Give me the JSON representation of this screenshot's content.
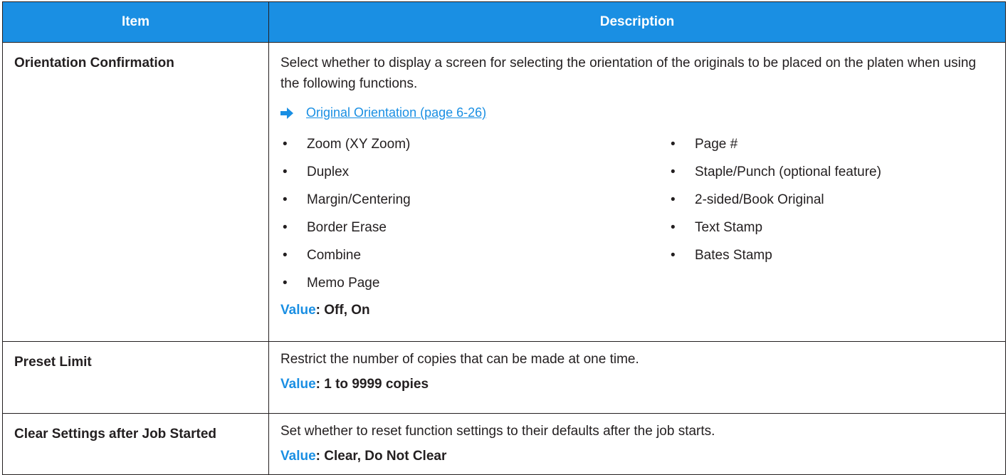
{
  "table": {
    "headers": {
      "item": "Item",
      "description": "Description"
    },
    "rows": [
      {
        "item": "Orientation Confirmation",
        "text": "Select whether to display a screen for selecting the orientation of the originals to be placed on the platen when using the following functions.",
        "reference": "Original Orientation (page 6-26)",
        "list_left": [
          "Zoom (XY Zoom)",
          "Duplex",
          "Margin/Centering",
          "Border Erase",
          "Combine",
          "Memo Page"
        ],
        "list_right": [
          "Page #",
          "Staple/Punch (optional feature)",
          "2-sided/Book Original",
          "Text Stamp",
          "Bates Stamp"
        ],
        "value_label": "Value",
        "value": ": Off, On"
      },
      {
        "item": "Preset Limit",
        "text": "Restrict the number of copies that can be made at one time.",
        "value_label": "Value",
        "value": ": 1 to 9999 copies"
      },
      {
        "item": "Clear Settings after Job Started",
        "text": "Set whether to reset function settings to their defaults after the job starts.",
        "value_label": "Value",
        "value": ": Clear, Do Not Clear"
      }
    ]
  },
  "bullet_char": "•",
  "colors": {
    "header_bg": "#1a8fe3",
    "accent": "#1a8fe3",
    "text": "#231f20",
    "border": "#231f20"
  },
  "icons": {
    "reference_arrow": "arrow-right-icon"
  }
}
